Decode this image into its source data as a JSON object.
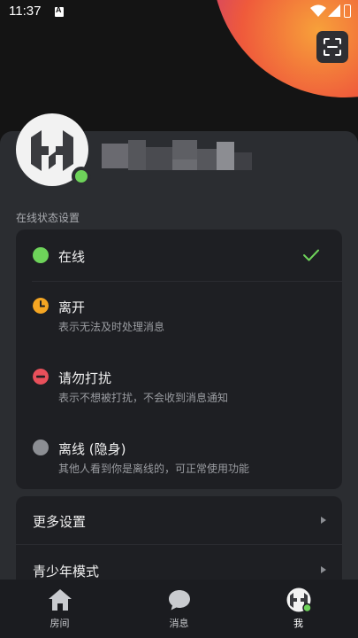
{
  "status_bar": {
    "time": "11:37"
  },
  "colors": {
    "online": "#6ED35A",
    "away": "#F5A623",
    "dnd": "#E8505B",
    "offline": "#8C8E93",
    "panel": "#2B2D31",
    "card": "#1E1F23"
  },
  "header": {
    "scan_icon": "scan-icon"
  },
  "profile": {
    "avatar_icon": "h-logo",
    "presence": "online"
  },
  "presence_section": {
    "label": "在线状态设置",
    "options": [
      {
        "title": "在线",
        "description": "",
        "icon": "green-dot-icon",
        "selected": true
      },
      {
        "title": "离开",
        "description": "表示无法及时处理消息",
        "icon": "clock-icon",
        "selected": false
      },
      {
        "title": "请勿打扰",
        "description": "表示不想被打扰，不会收到消息通知",
        "icon": "minus-circle-icon",
        "selected": false
      },
      {
        "title": "离线 (隐身)",
        "description": "其他人看到你是离线的，可正常使用功能",
        "icon": "grey-dot-icon",
        "selected": false
      }
    ]
  },
  "menu": {
    "items": [
      {
        "label": "更多设置"
      },
      {
        "label": "青少年模式"
      }
    ]
  },
  "bottom_nav": {
    "items": [
      {
        "label": "房间",
        "icon": "home-icon",
        "active": false
      },
      {
        "label": "消息",
        "icon": "chat-bubble-icon",
        "active": false
      },
      {
        "label": "我",
        "icon": "h-logo-avatar-icon",
        "active": true
      }
    ]
  }
}
